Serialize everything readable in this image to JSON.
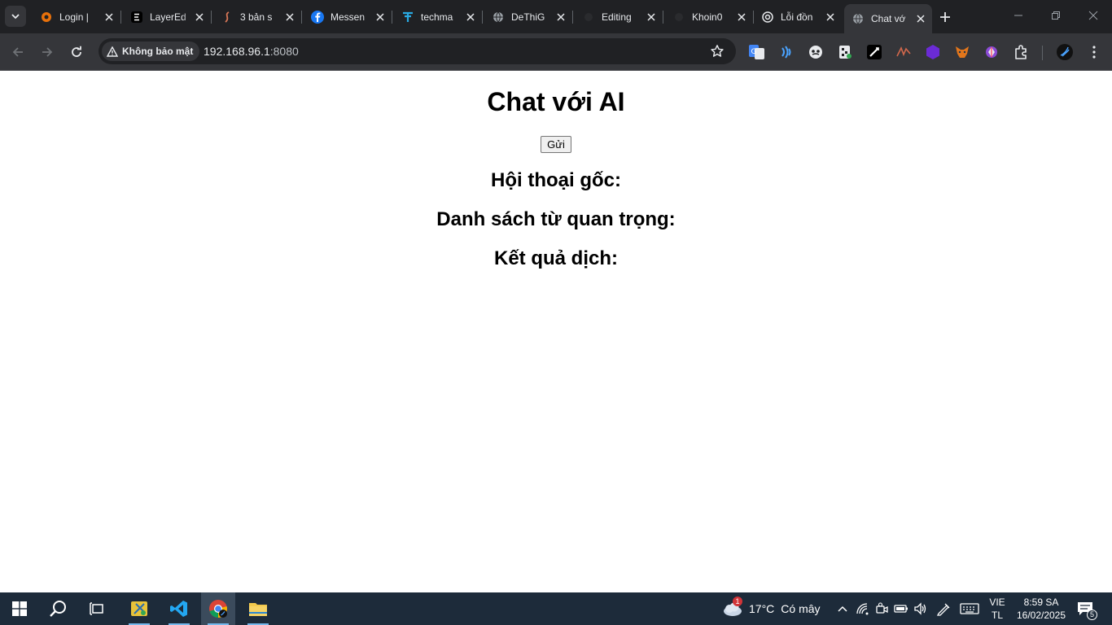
{
  "browser": {
    "tabs": [
      {
        "title": "Login |",
        "icon": "orange-ring-icon"
      },
      {
        "title": "LayerEd",
        "icon": "e-logo-icon"
      },
      {
        "title": "3 bản s",
        "icon": "swirl-icon"
      },
      {
        "title": "Messen",
        "icon": "facebook-icon"
      },
      {
        "title": "techma",
        "icon": "t-logo-icon"
      },
      {
        "title": "DeThiG",
        "icon": "globe-icon"
      },
      {
        "title": "Editing",
        "icon": "dark-dot-icon"
      },
      {
        "title": "Khoin0",
        "icon": "dark-dot-icon"
      },
      {
        "title": "Lỗi đồn",
        "icon": "openai-icon"
      },
      {
        "title": "Chat vớ",
        "icon": "globe-icon",
        "active": true
      }
    ],
    "security_label": "Không bảo mật",
    "url_host": "192.168.96.1",
    "url_rest": ":8080"
  },
  "page": {
    "title": "Chat với AI",
    "send_label": "Gửi",
    "headings": {
      "original": "Hội thoại gốc:",
      "keywords": "Danh sách từ quan trọng:",
      "translation": "Kết quả dịch:"
    }
  },
  "taskbar": {
    "weather_badge": "1",
    "temperature": "17°C",
    "weather_desc": "Có mây",
    "lang_line1": "VIE",
    "lang_line2": "TL",
    "time": "8:59 SA",
    "date": "16/02/2025",
    "notification_count": "5"
  },
  "colors": {
    "tabstrip_bg": "#202124",
    "toolbar_bg": "#35363a",
    "taskbar_bg": "#1d2b3a",
    "accent_blue": "#76b9ed"
  }
}
